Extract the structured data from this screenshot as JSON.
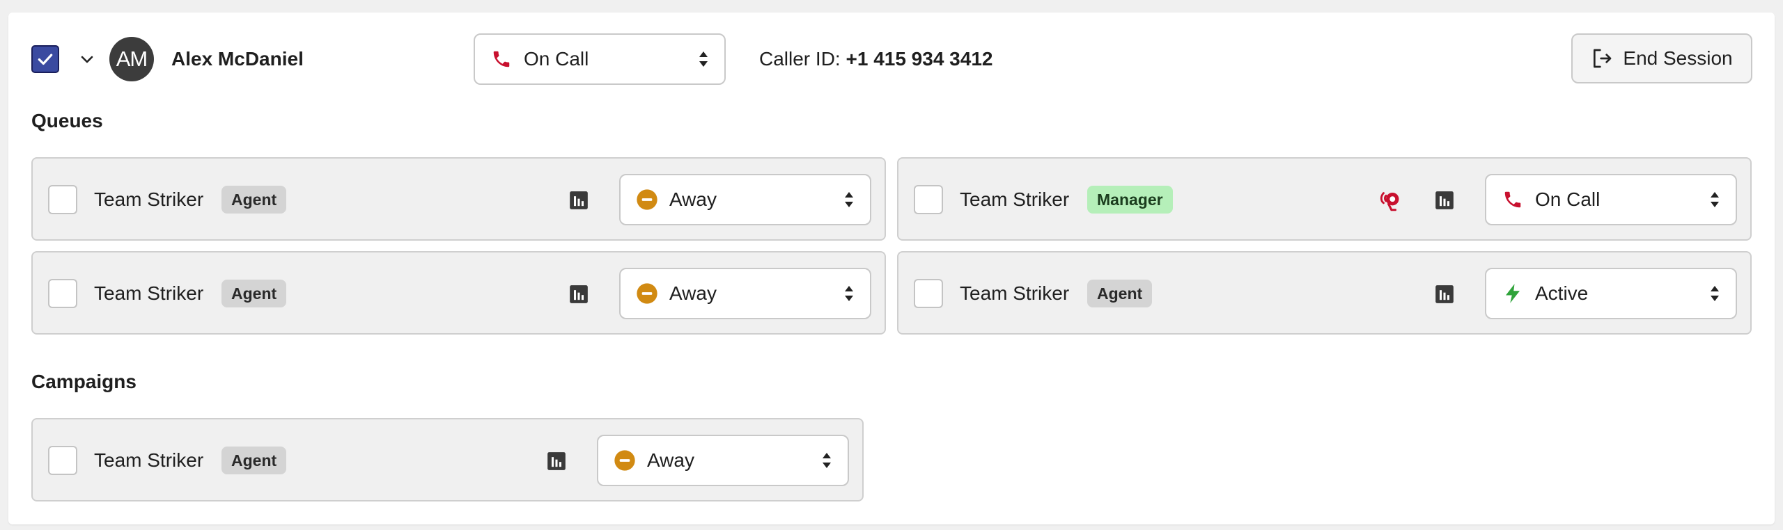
{
  "header": {
    "checked": true,
    "avatar_initials": "AM",
    "user_name": "Alex McDaniel",
    "status": {
      "label": "On Call",
      "icon": "phone-icon",
      "color": "#c8102e"
    },
    "caller_id_label": "Caller ID:",
    "caller_id_value": "+1 415 934 3412",
    "end_session_label": "End Session"
  },
  "queues_title": "Queues",
  "queues": [
    {
      "team": "Team Striker",
      "role": "Agent",
      "status": "Away",
      "status_icon": "away-icon"
    },
    {
      "team": "Team Striker",
      "role": "Manager",
      "status": "On Call",
      "status_icon": "phone-icon",
      "headset_icon": "headset-icon"
    },
    {
      "team": "Team Striker",
      "role": "Agent",
      "status": "Away",
      "status_icon": "away-icon"
    },
    {
      "team": "Team Striker",
      "role": "Agent",
      "status": "Active",
      "status_icon": "lightning-icon"
    }
  ],
  "campaigns_title": "Campaigns",
  "campaigns": [
    {
      "team": "Team Striker",
      "role": "Agent",
      "status": "Away",
      "status_icon": "away-icon"
    }
  ],
  "colors": {
    "away": "#d18a12",
    "on_call": "#c8102e",
    "active": "#2fa33a",
    "checkbox_checked": "#3a4aa0",
    "manager_badge": "#b5efb9",
    "agent_badge": "#d4d4d4"
  }
}
